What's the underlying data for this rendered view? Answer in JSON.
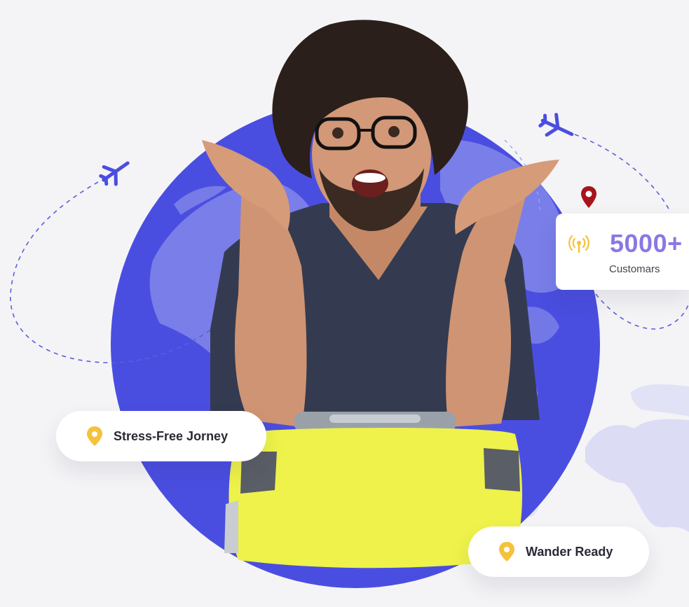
{
  "stat": {
    "value": "5000+",
    "label": "Customars"
  },
  "badges": {
    "left": "Stress-Free Jorney",
    "right": "Wander Ready"
  },
  "icons": {
    "pin": "location-pin-icon",
    "signal": "broadcast-signal-icon",
    "plane": "airplane-icon"
  },
  "colors": {
    "globe": "#4a4ee0",
    "accent": "#8a78e6",
    "pin_yellow": "#f5c23c",
    "pin_red": "#a8141e",
    "suitcase": "#eef24a",
    "shirt": "#343b50"
  }
}
